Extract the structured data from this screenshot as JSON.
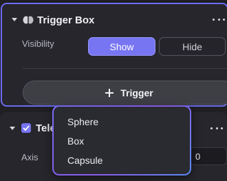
{
  "trigger_box": {
    "title": "Trigger Box",
    "visibility_label": "Visibility",
    "visibility_options": [
      "Show",
      "Hide"
    ],
    "visibility_selected": "Show",
    "add_button_label": "Trigger"
  },
  "teleport": {
    "title": "Tele",
    "checked": true,
    "axis_label": "Axis",
    "axis_values": [
      "0",
      "0"
    ]
  },
  "dropdown": {
    "options": [
      "Sphere",
      "Box",
      "Capsule"
    ]
  },
  "colors": {
    "accent": "#7775f2",
    "panel_bg": "#26262c",
    "page_bg": "#1f1f24"
  },
  "icons": {
    "collapse": "chevron-down-icon",
    "trigger": "trigger-box-icon",
    "more": "more-icon",
    "add": "plus-icon",
    "checkbox": "checkmark-icon"
  }
}
